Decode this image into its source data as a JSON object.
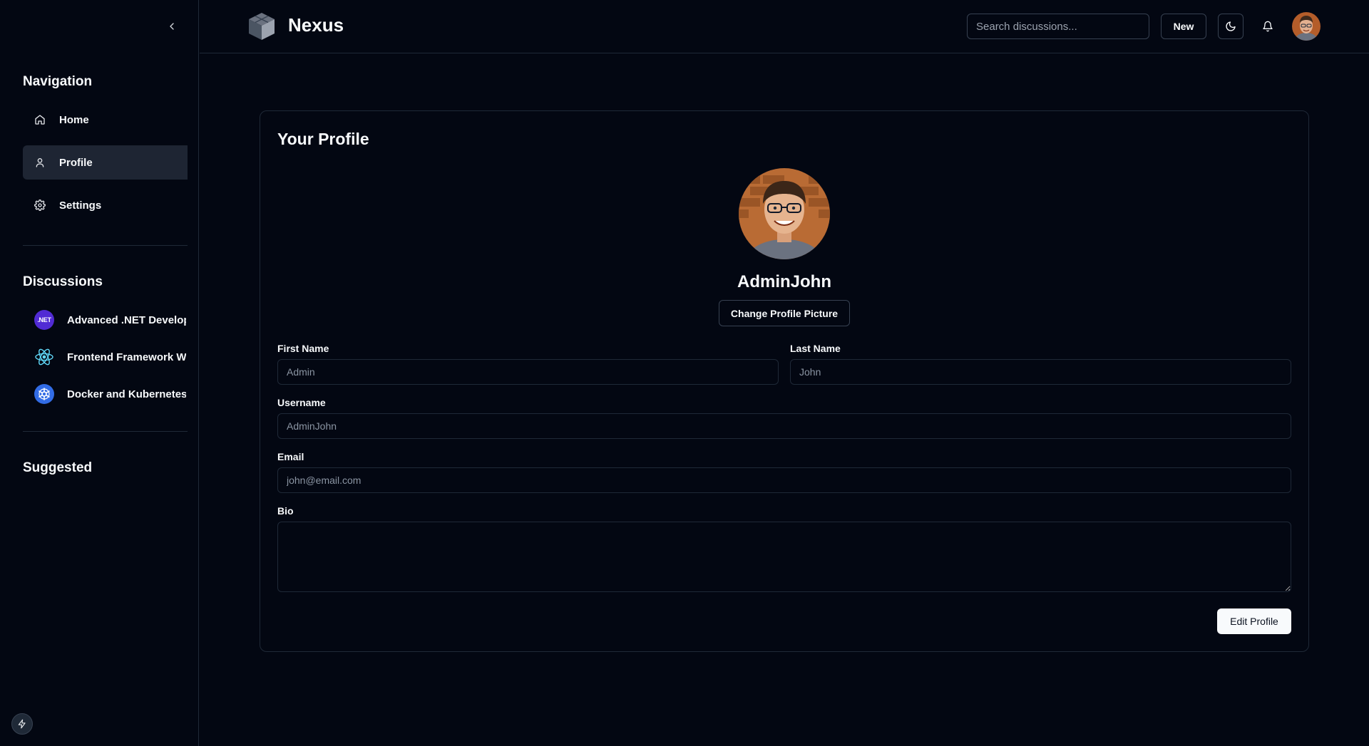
{
  "app": {
    "brand": "Nexus"
  },
  "header": {
    "search_placeholder": "Search discussions...",
    "new_label": "New",
    "icons": {
      "theme": "moon-icon",
      "notifications": "bell-icon",
      "logo": "cube-logo"
    }
  },
  "sidebar": {
    "navigation_title": "Navigation",
    "nav_items": [
      {
        "label": "Home",
        "icon": "home-icon",
        "active": false
      },
      {
        "label": "Profile",
        "icon": "user-icon",
        "active": true
      },
      {
        "label": "Settings",
        "icon": "gear-icon",
        "active": false
      }
    ],
    "discussions_title": "Discussions",
    "discussions": [
      {
        "label": "Advanced .NET Development",
        "icon": "dotnet-icon",
        "icon_text": ".NET",
        "color": "#512bd4"
      },
      {
        "label": "Frontend Framework Wars",
        "icon": "react-icon",
        "color": "#61dafb"
      },
      {
        "label": "Docker and Kubernetes",
        "icon": "kubernetes-icon",
        "color": "#326ce5"
      }
    ],
    "suggested_title": "Suggested"
  },
  "profile": {
    "title": "Your Profile",
    "username_display": "AdminJohn",
    "change_picture_label": "Change Profile Picture",
    "fields": {
      "first_name": {
        "label": "First Name",
        "placeholder": "Admin"
      },
      "last_name": {
        "label": "Last Name",
        "placeholder": "John"
      },
      "username": {
        "label": "Username",
        "placeholder": "AdminJohn"
      },
      "email": {
        "label": "Email",
        "placeholder": "john@email.com"
      },
      "bio": {
        "label": "Bio",
        "value": ""
      }
    },
    "edit_label": "Edit Profile"
  },
  "colors": {
    "background": "#030712",
    "border": "#1f2937",
    "active_nav": "#1e2533",
    "primary_button": "#f8fafc"
  }
}
